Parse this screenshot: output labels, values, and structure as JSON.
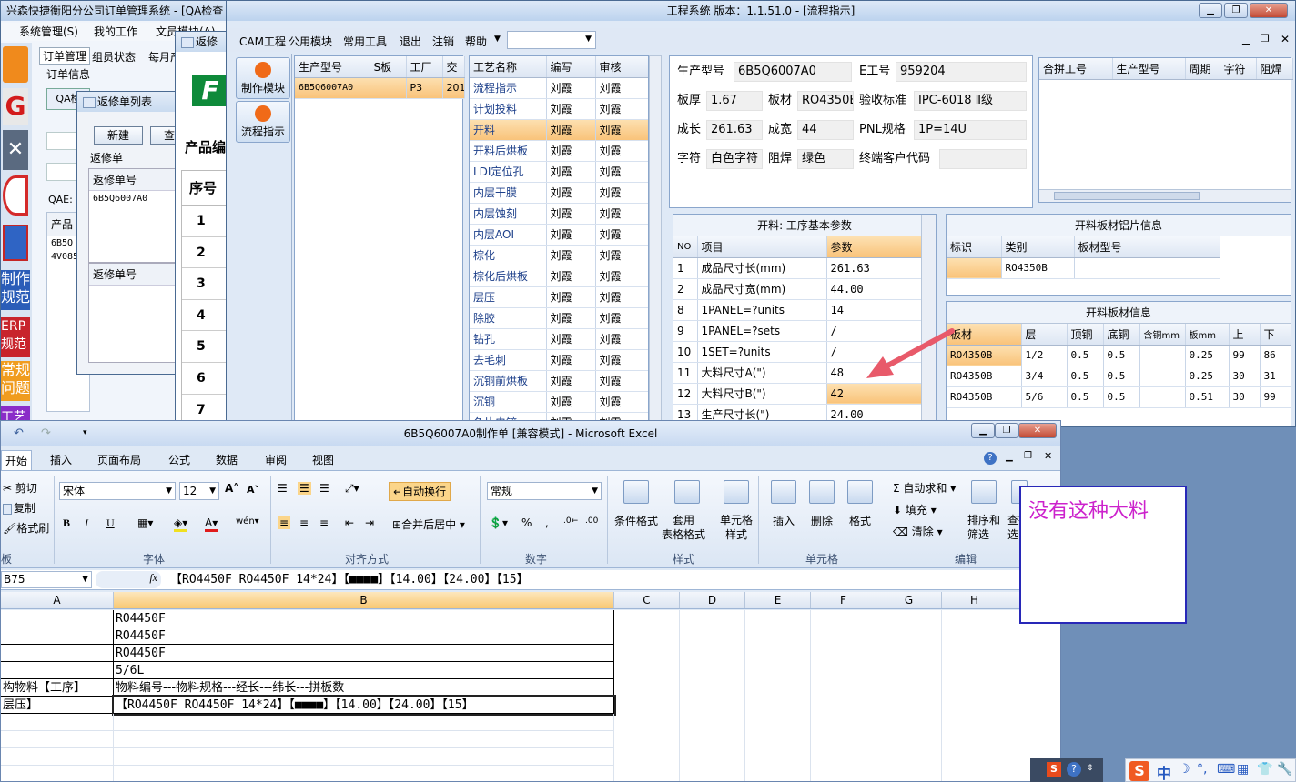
{
  "left_app": {
    "title": "兴森快捷衡阳分公司订单管理系统 - [QA检查",
    "menu": [
      "系统管理(S)",
      "我的工作",
      "文员模块(A)"
    ],
    "tabs": [
      "订单管理",
      "组员状态",
      "每月产"
    ],
    "order_info": "订单信息",
    "qa_label": "QAE:",
    "product_label": "产品",
    "list_rows": [
      "6B5Q",
      "4V085"
    ],
    "side_labels": [
      "制作\n规范",
      "ERP\n规范",
      "常规\n问题",
      "工艺"
    ]
  },
  "repair_list": {
    "title": "返修单列表",
    "new_button": "新建",
    "query_button": "查",
    "section1": "返修单",
    "col_header": "返修单号",
    "row_value": "6B5Q6007A0",
    "section2": "返修单号"
  },
  "repair_window": {
    "title": "返修",
    "product_label": "产品编",
    "seq_header": "序号",
    "seq_values": [
      "1",
      "2",
      "3",
      "4",
      "5",
      "6",
      "7"
    ]
  },
  "eng": {
    "title": "工程系统  版本：1.1.51.0 - [流程指示]",
    "menu": [
      "CAM工程",
      "公用模块",
      "常用工具",
      "退出",
      "注销",
      "帮助"
    ],
    "side_buttons": [
      "制作模块",
      "流程指示"
    ],
    "prod_table": {
      "headers": [
        "生产型号",
        "S板",
        "工厂",
        "交"
      ],
      "row": [
        "6B5Q6007A0",
        "",
        "P3",
        "201"
      ]
    },
    "process_table": {
      "headers": [
        "工艺名称",
        "编写",
        "审核"
      ],
      "rows": [
        [
          "流程指示",
          "刘霞",
          "刘霞"
        ],
        [
          "计划投料",
          "刘霞",
          "刘霞"
        ],
        [
          "开料",
          "刘霞",
          "刘霞"
        ],
        [
          "开料后烘板",
          "刘霞",
          "刘霞"
        ],
        [
          "LDI定位孔",
          "刘霞",
          "刘霞"
        ],
        [
          "内层干膜",
          "刘霞",
          "刘霞"
        ],
        [
          "内层蚀刻",
          "刘霞",
          "刘霞"
        ],
        [
          "内层AOI",
          "刘霞",
          "刘霞"
        ],
        [
          "棕化",
          "刘霞",
          "刘霞"
        ],
        [
          "棕化后烘板",
          "刘霞",
          "刘霞"
        ],
        [
          "层压",
          "刘霞",
          "刘霞"
        ],
        [
          "除胶",
          "刘霞",
          "刘霞"
        ],
        [
          "钻孔",
          "刘霞",
          "刘霞"
        ],
        [
          "去毛刺",
          "刘霞",
          "刘霞"
        ],
        [
          "沉铜前烘板",
          "刘霞",
          "刘霞"
        ],
        [
          "沉铜",
          "刘霞",
          "刘霞"
        ],
        [
          "负片电镀",
          "刘霞",
          "刘霞"
        ]
      ],
      "selected_index": 2
    },
    "info": {
      "model_label": "生产型号",
      "model_value": "6B5Q6007A0",
      "e_label": "E工号",
      "e_value": "959204",
      "thick_label": "板厚",
      "thick_value": "1.67",
      "mat_label": "板材",
      "mat_value": "RO4350B",
      "std_label": "验收标准",
      "std_value": "IPC-6018 Ⅱ级",
      "len_label": "成长",
      "len_value": "261.63",
      "wid_label": "成宽",
      "wid_value": "44",
      "pnl_label": "PNL规格",
      "pnl_value": "1P=14U",
      "char_label": "字符",
      "char_value": "白色字符",
      "mask_label": "阻焊",
      "mask_value": "绿色",
      "cust_label": "终端客户代码",
      "cust_value": ""
    },
    "merge_table_headers": [
      "合拼工号",
      "生产型号",
      "周期",
      "字符",
      "阻焊"
    ],
    "params": {
      "title": "开料: 工序基本参数",
      "headers": [
        "NO",
        "项目",
        "参数"
      ],
      "rows": [
        [
          "1",
          "成品尺寸长(mm)",
          "261.63"
        ],
        [
          "2",
          "成品尺寸宽(mm)",
          "44.00"
        ],
        [
          "8",
          "1PANEL=?units",
          "14"
        ],
        [
          "9",
          "1PANEL=?sets",
          "/"
        ],
        [
          "10",
          "1SET=?units",
          "/"
        ],
        [
          "11",
          "大料尺寸A(\")",
          "48"
        ],
        [
          "12",
          "大料尺寸B(\")",
          "42"
        ],
        [
          "13",
          "生产尺寸长(\")",
          "24.00"
        ]
      ]
    },
    "foil": {
      "title": "开料板材铝片信息",
      "headers": [
        "标识",
        "类别",
        "板材型号"
      ],
      "row": [
        "",
        "RO4350B",
        ""
      ]
    },
    "board": {
      "title": "开料板材信息",
      "headers": [
        "板材",
        "层",
        "顶铜",
        "底铜",
        "含铜mm",
        "板mm",
        "上",
        "下"
      ],
      "rows": [
        [
          "RO4350B",
          "1/2",
          "0.5",
          "0.5",
          "",
          "0.25",
          "99",
          "86"
        ],
        [
          "RO4350B",
          "3/4",
          "0.5",
          "0.5",
          "",
          "0.25",
          "30",
          "31"
        ],
        [
          "RO4350B",
          "5/6",
          "0.5",
          "0.5",
          "",
          "0.51",
          "30",
          "99"
        ]
      ]
    }
  },
  "excel": {
    "title": "6B5Q6007A0制作单 [兼容模式] - Microsoft Excel",
    "tabs": [
      "开始",
      "插入",
      "页面布局",
      "公式",
      "数据",
      "审阅",
      "视图"
    ],
    "clipboard": {
      "cut": "剪切",
      "copy": "复制",
      "format": "格式刷",
      "group": "板"
    },
    "font": {
      "name": "宋体",
      "size": "12",
      "group": "字体"
    },
    "align": {
      "wrap": "自动换行",
      "merge": "合并后居中",
      "group": "对齐方式"
    },
    "number": {
      "format": "常规",
      "group": "数字"
    },
    "styles": {
      "cond": "条件格式",
      "table": "套用\n表格格式",
      "cell": "单元格\n样式",
      "group": "样式"
    },
    "cells": {
      "insert": "插入",
      "delete": "删除",
      "format": "格式",
      "group": "单元格"
    },
    "edit": {
      "autosum": "自动求和",
      "fill": "填充",
      "clear": "清除",
      "sort": "排序和\n筛选",
      "find": "查找\n选",
      "group": "编辑"
    },
    "name_box": "B75",
    "fx": "fx",
    "formula": "【RO4450F RO4450F  14*24】【■■■■】【14.00】【24.00】【15】",
    "columns": [
      "A",
      "B",
      "C",
      "D",
      "E",
      "F",
      "G",
      "H"
    ],
    "rows": [
      [
        "",
        "RO4450F"
      ],
      [
        "",
        "RO4450F"
      ],
      [
        "",
        "RO4450F"
      ],
      [
        "",
        "5/6L"
      ],
      [
        "构物料【工序】",
        "物料编号---物料规格---经长---纬长---拼板数"
      ],
      [
        "层压】",
        "【RO4450F RO4450F  14*24】【■■■■】【14.00】【24.00】【15】"
      ],
      [
        "",
        ""
      ],
      [
        "",
        ""
      ],
      [
        "",
        ""
      ],
      [
        "",
        ""
      ]
    ]
  },
  "annotation": {
    "text": "没有这种大料",
    "color": "#cc22cc"
  },
  "taskbar": {
    "ime": "中"
  }
}
